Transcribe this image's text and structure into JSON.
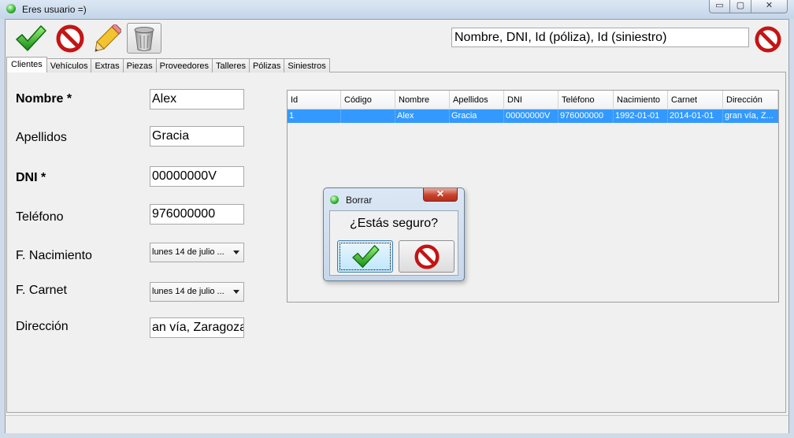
{
  "window": {
    "title": "Eres usuario =)",
    "min_glyph": "▭",
    "max_glyph": "▢",
    "close_glyph": "✕"
  },
  "toolbar": {
    "accept_icon": "green-check-icon",
    "cancel_icon": "red-forbidden-icon",
    "edit_icon": "pencil-icon",
    "delete_icon": "trash-can-icon"
  },
  "search": {
    "value": "Nombre, DNI, Id (póliza), Id (siniestro)",
    "clear_icon": "red-forbidden-icon"
  },
  "tabs": [
    {
      "label": "Clientes",
      "active": true
    },
    {
      "label": "Vehículos"
    },
    {
      "label": "Extras"
    },
    {
      "label": "Piezas"
    },
    {
      "label": "Proveedores"
    },
    {
      "label": "Talleres"
    },
    {
      "label": "Pólizas"
    },
    {
      "label": "Siniestros"
    }
  ],
  "form": {
    "nombre": {
      "label": "Nombre *",
      "value": "Alex"
    },
    "apellidos": {
      "label": "Apellidos",
      "value": "Gracia"
    },
    "dni": {
      "label": "DNI *",
      "value": "00000000V"
    },
    "telefono": {
      "label": "Teléfono",
      "value": "976000000"
    },
    "nacimiento": {
      "label": "F. Nacimiento",
      "value": "lunes 14 de julio ..."
    },
    "carnet": {
      "label": "F. Carnet",
      "value": "lunes 14 de julio ..."
    },
    "direccion": {
      "label": "Dirección",
      "value": "an vía, Zaragoza"
    }
  },
  "table": {
    "columns": [
      "Id",
      "Código",
      "Nombre",
      "Apellidos",
      "DNI",
      "Teléfono",
      "Nacimiento",
      "Carnet",
      "Dirección"
    ],
    "rows": [
      [
        "1",
        "",
        "Alex",
        "Gracia",
        "00000000V",
        "976000000",
        "1992-01-01",
        "2014-01-01",
        "gran vía, Z..."
      ]
    ],
    "selection_color": "#3399ff"
  },
  "dialog": {
    "title": "Borrar",
    "close_glyph": "✕",
    "message": "¿Estás seguro?",
    "yes_icon": "green-check-icon",
    "no_icon": "red-forbidden-icon"
  },
  "colors": {
    "accept": "#2fae2f",
    "cancel": "#d31b1b",
    "frame": "#cfdbe8"
  }
}
